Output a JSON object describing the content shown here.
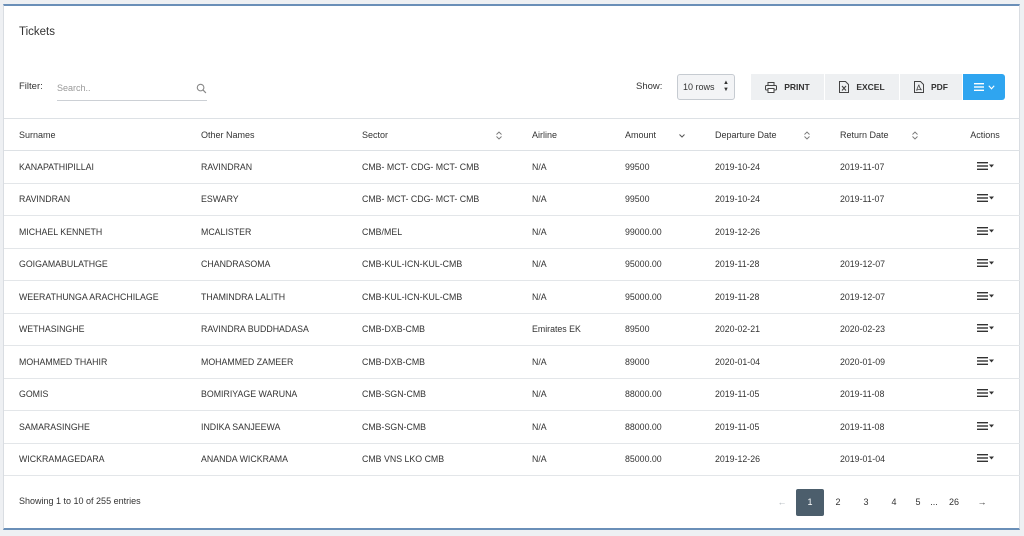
{
  "panel": {
    "title": "Tickets"
  },
  "filter": {
    "label": "Filter:",
    "placeholder": "Search.."
  },
  "show": {
    "label": "Show:",
    "selected": "10 rows"
  },
  "toolbar": {
    "print_label": "PRINT",
    "excel_label": "EXCEL",
    "pdf_label": "PDF"
  },
  "table": {
    "columns": [
      "Surname",
      "Other Names",
      "Sector",
      "Airline",
      "Amount",
      "Departure Date",
      "Return Date",
      "Actions"
    ],
    "rows": [
      [
        "KANAPATHIPILLAI",
        "RAVINDRAN",
        "CMB- MCT- CDG- MCT- CMB",
        "N/A",
        "99500",
        "2019-10-24",
        "2019-11-07"
      ],
      [
        "RAVINDRAN",
        "ESWARY",
        "CMB- MCT- CDG- MCT- CMB",
        "N/A",
        "99500",
        "2019-10-24",
        "2019-11-07"
      ],
      [
        "MICHAEL KENNETH",
        "MCALISTER",
        "CMB/MEL",
        "N/A",
        "99000.00",
        "2019-12-26",
        ""
      ],
      [
        "GOIGAMABULATHGE",
        "CHANDRASOMA",
        "CMB-KUL-ICN-KUL-CMB",
        "N/A",
        "95000.00",
        "2019-11-28",
        "2019-12-07"
      ],
      [
        "WEERATHUNGA ARACHCHILAGE",
        "THAMINDRA LALITH",
        "CMB-KUL-ICN-KUL-CMB",
        "N/A",
        "95000.00",
        "2019-11-28",
        "2019-12-07"
      ],
      [
        "WETHASINGHE",
        "RAVINDRA BUDDHADASA",
        "CMB-DXB-CMB",
        "Emirates EK",
        "89500",
        "2020-02-21",
        "2020-02-23"
      ],
      [
        "MOHAMMED THAHIR",
        "MOHAMMED ZAMEER",
        "CMB-DXB-CMB",
        "N/A",
        "89000",
        "2020-01-04",
        "2020-01-09"
      ],
      [
        "GOMIS",
        "BOMIRIYAGE WARUNA",
        "CMB-SGN-CMB",
        "N/A",
        "88000.00",
        "2019-11-05",
        "2019-11-08"
      ],
      [
        "SAMARASINGHE",
        "INDIKA SANJEEWA",
        "CMB-SGN-CMB",
        "N/A",
        "88000.00",
        "2019-11-05",
        "2019-11-08"
      ],
      [
        "WICKRAMAGEDARA",
        "ANANDA WICKRAMA",
        "CMB VNS LKO CMB",
        "N/A",
        "85000.00",
        "2019-12-26",
        "2019-01-04"
      ]
    ]
  },
  "footer": {
    "info": "Showing 1 to 10 of 255 entries"
  },
  "pagination": {
    "prev": "←",
    "pages": [
      "1",
      "2",
      "3",
      "4",
      "5"
    ],
    "ellipsis": "...",
    "last": "26",
    "next": "→",
    "active": "1"
  },
  "colors": {
    "accent": "#2fa5f0",
    "active_page": "#4c5e6c",
    "panel_border": "#6a8fb8"
  },
  "icons": [
    "search-icon",
    "printer-icon",
    "excel-icon",
    "pdf-icon",
    "menu-icon",
    "chevron-down-icon",
    "sort-icon",
    "sort-desc-icon"
  ]
}
